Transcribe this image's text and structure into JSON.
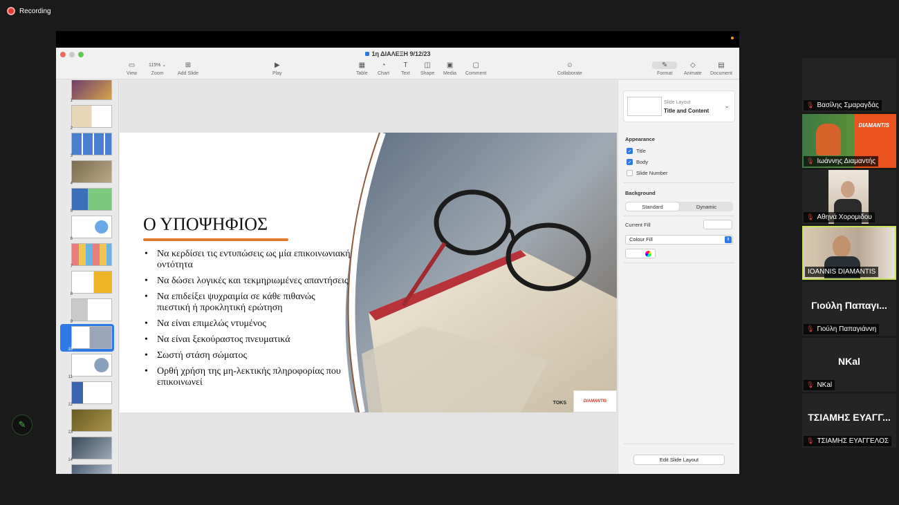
{
  "recording": {
    "label": "Recording"
  },
  "app": {
    "doc_title": "1η ΔΙΑΛΕΞΗ 9/12/23",
    "toolbar": {
      "view": "View",
      "zoom_value": "115%",
      "zoom": "Zoom",
      "add_slide": "Add Slide",
      "play": "Play",
      "table": "Table",
      "chart": "Chart",
      "text": "Text",
      "shape": "Shape",
      "media": "Media",
      "comment": "Comment",
      "collaborate": "Collaborate",
      "format": "Format",
      "animate": "Animate",
      "document": "Document"
    },
    "slide_numbers": [
      "1",
      "2",
      "3",
      "4",
      "5",
      "6",
      "7",
      "8",
      "9",
      "10",
      "11",
      "12",
      "13",
      "14"
    ],
    "selected_slide": "10"
  },
  "slide": {
    "title": "Ο ΥΠΟΨΗΦΙΟΣ",
    "bullets": [
      "Να κερδίσει τις εντυπώσεις ως μία επικοινωνιακή οντότητα",
      "Να δώσει λογικές και τεκμηριωμένες απαντήσεις",
      "Να επιδείξει ψυχραιμία σε κάθε πιθανώς πιεστική ή προκλητική ερώτηση",
      "Να είναι επιμελώς ντυμένος",
      "Να είναι ξεκούραστος πνευματικά",
      "Σωστή στάση σώματος",
      "Ορθή χρήση της μη-λεκτικής πληροφορίας που επικοινωνεί"
    ],
    "logo": "DIAMANTIS",
    "logo_small": "TOKS"
  },
  "inspector": {
    "layout_small": "Slide Layout",
    "layout_name": "Title and Content",
    "appearance": "Appearance",
    "title_check": "Title",
    "body_check": "Body",
    "slide_number_check": "Slide Number",
    "background": "Background",
    "standard": "Standard",
    "dynamic": "Dynamic",
    "current_fill": "Current Fill",
    "fill_type": "Colour Fill",
    "edit_layout": "Edit Slide Layout"
  },
  "participants": [
    {
      "name": "Βασίλης Σμαραγδάς",
      "big": ""
    },
    {
      "name": "Ιωάννης Διαμαντής",
      "big": ""
    },
    {
      "name": "Αθηνά Χορομιδου",
      "big": ""
    },
    {
      "name": "IOANNIS DIAMANTIS",
      "big": ""
    },
    {
      "name": "Γιούλη Παπαγιάννη",
      "big": "Γιούλη Παπαγι..."
    },
    {
      "name": "NKal",
      "big": "NKal"
    },
    {
      "name": "ΤΣΙΑΜΗΣ ΕΥΑΓΓΕΛΟΣ",
      "big": "ΤΣΙΑΜΗΣ ΕΥΑΓΓ..."
    }
  ],
  "colors": {
    "accent": "#2f7ae5",
    "active_speaker": "#c8e25a",
    "underline": "#e07a2f"
  }
}
